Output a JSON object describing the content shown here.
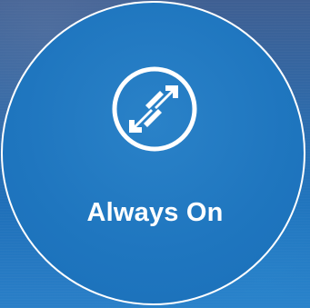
{
  "tile": {
    "label": "Always On",
    "icon": "sync-arrows-icon",
    "accent": "#1f76bf",
    "border_color": "#ffffff"
  }
}
